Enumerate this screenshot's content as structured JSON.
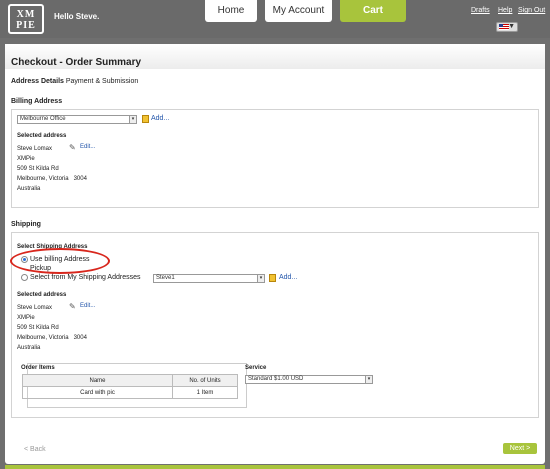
{
  "logo": {
    "line1": "XM",
    "line2": "PIE"
  },
  "greeting": "Hello Steve.",
  "nav": {
    "home": "Home",
    "account": "My Account",
    "cart": "Cart"
  },
  "links": {
    "drafts": "Drafts",
    "help": "Help",
    "signout": "Sign Out"
  },
  "flag_arrow": "▼",
  "page_title": "Checkout - Order Summary",
  "steps": {
    "current": "Address Details",
    "next": "Payment & Submission"
  },
  "billing": {
    "label": "Billing Address",
    "select_value": "Melbourne Office",
    "add": "Add...",
    "selected_label": "Selected address",
    "edit": "Edit...",
    "lines": [
      "Steve Lomax",
      "XMPie",
      "509 St Kilda Rd",
      "Melbourne, Victoria   3004",
      "Australia"
    ]
  },
  "shipping": {
    "label": "Shipping",
    "select_label": "Select Shipping Address",
    "option1": "Use billing Address",
    "option_pickup": "Pickup",
    "option2": "Select from My Shipping Addresses",
    "select_value": "Steve1",
    "add": "Add...",
    "selected_label": "Selected address",
    "edit": "Edit...",
    "lines": [
      "Steve Lomax",
      "XMPie",
      "509 St Kilda Rd",
      "Melbourne, Victoria   3004",
      "Australia"
    ]
  },
  "order_items": {
    "label": "Order Items",
    "headers": [
      "Name",
      "No. of Units"
    ],
    "rows": [
      [
        "Card with pic",
        "1 Item"
      ]
    ]
  },
  "service": {
    "label": "Service",
    "value": "Standard $1.00 USD"
  },
  "back": "< Back",
  "next": "Next >",
  "colors": {
    "accent": "#a8c43c",
    "annotation": "#d8261c",
    "link": "#2255aa"
  }
}
